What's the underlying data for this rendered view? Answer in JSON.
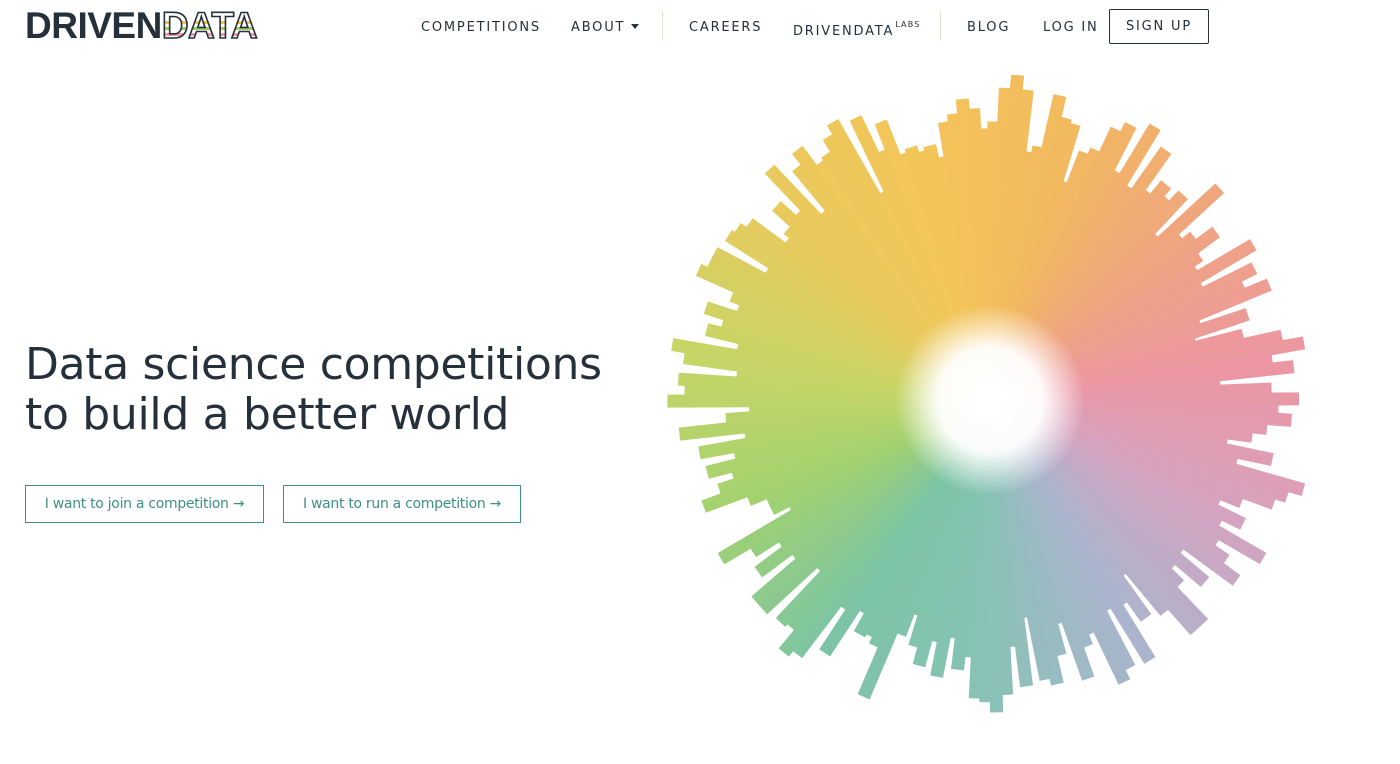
{
  "brand": {
    "part1": "DRIVEN",
    "part2": "DATA"
  },
  "nav": {
    "competitions": "COMPETITIONS",
    "about": "ABOUT",
    "careers": "CAREERS",
    "labs": "DRIVENDATA",
    "labs_sup": "LABS",
    "blog": "BLOG",
    "login": "LOG IN",
    "signup": "SIGN UP"
  },
  "hero": {
    "line1": "Data science competitions",
    "line2": "to build a better world",
    "cta_join": "I want to join a competition →",
    "cta_run": "I want to run a competition →"
  },
  "colors": {
    "text": "#25303b",
    "accent": "#3f8f82",
    "burst_palette": [
      "#f3c559",
      "#f2b95f",
      "#efa481",
      "#ec96a3",
      "#d5a3bf",
      "#abb4cd",
      "#88c2b6",
      "#7cc4a4",
      "#a2d16f",
      "#c8d566",
      "#e9c95c"
    ]
  },
  "burst_lengths": [
    0.86,
    0.68,
    0.7,
    0.86,
    0.8,
    0.79,
    0.62,
    0.72,
    0.74,
    0.82,
    0.85,
    0.71,
    0.88,
    0.69,
    0.84,
    0.71,
    0.76,
    0.73,
    0.77,
    0.63,
    0.86,
    0.68,
    0.71,
    0.77,
    0.69,
    0.66,
    0.84,
    0.65,
    0.81,
    0.76,
    0.83,
    0.6,
    0.74,
    0.57,
    0.71,
    0.82,
    0.88,
    0.78,
    0.84,
    0.62,
    0.77,
    0.85,
    0.79,
    0.83,
    0.76,
    0.72,
    0.65,
    0.79,
    0.69,
    0.9,
    0.86,
    0.83,
    0.74,
    0.68,
    0.77,
    0.71,
    0.87,
    0.73,
    0.78,
    0.84,
    0.66,
    0.77,
    0.67,
    0.72,
    0.85,
    0.85,
    0.75,
    0.59,
    0.73,
    0.66,
    0.84,
    0.65,
    0.83,
    0.86,
    0.69,
    0.72,
    0.81,
    0.63,
    0.72,
    0.8,
    0.78,
    0.59,
    0.79,
    0.67,
    0.81,
    0.86,
    0.83,
    0.82,
    0.7,
    0.74,
    0.65,
    0.77,
    0.67,
    0.75,
    0.7,
    0.61,
    0.68,
    0.89,
    0.74,
    0.72,
    0.73,
    0.67,
    0.83,
    0.69,
    0.88,
    0.9,
    0.83,
    0.84,
    0.65,
    0.85,
    0.85,
    0.68,
    0.79,
    0.69,
    0.77,
    0.86,
    0.61,
    0.66,
    0.66,
    0.71,
    0.84,
    0.78,
    0.73,
    0.8,
    0.71,
    0.81,
    0.67,
    0.86,
    0.72,
    0.65,
    0.89,
    0.84,
    0.86,
    0.69,
    0.85,
    0.89,
    0.7,
    0.8,
    0.76,
    0.82,
    0.73,
    0.76,
    0.88,
    0.86,
    0.86,
    0.7,
    0.85,
    0.84,
    0.82,
    0.7,
    0.72,
    0.79,
    0.73,
    0.88,
    0.68,
    0.83,
    0.87,
    0.8,
    0.81,
    0.85,
    0.88,
    0.63,
    0.86,
    0.74,
    0.82,
    0.71,
    0.72,
    0.7,
    0.71,
    0.67,
    0.77,
    0.79,
    0.83,
    0.8,
    0.74,
    0.76,
    0.86,
    0.9
  ]
}
